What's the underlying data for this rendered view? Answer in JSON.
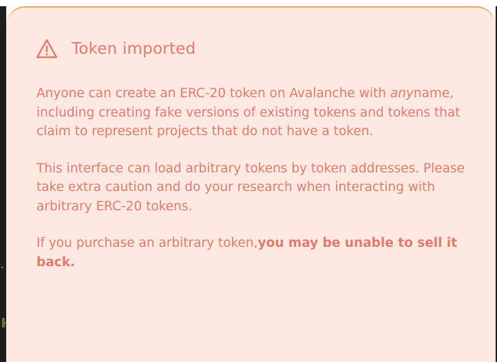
{
  "dialog": {
    "title": "Token imported",
    "warning_icon": "warning-triangle-icon",
    "colors": {
      "text": "#e27a6c",
      "background": "#fde9e2",
      "border": "#f0a35a"
    },
    "paragraphs": {
      "p1_lead": "Anyone can create an ERC-20 token on Avalanche with ",
      "p1_em": "any",
      "p1_rest": "name, including creating fake versions of existing tokens and tokens that claim to represent projects that do not have a token.",
      "p2": "This interface can load arbitrary tokens by token addresses. Please take extra caution and do your research when interacting with arbitrary ERC-20 tokens.",
      "p3_lead": "If you purchase an arbitrary token,",
      "p3_strong": "you may be unable to sell it back."
    }
  }
}
